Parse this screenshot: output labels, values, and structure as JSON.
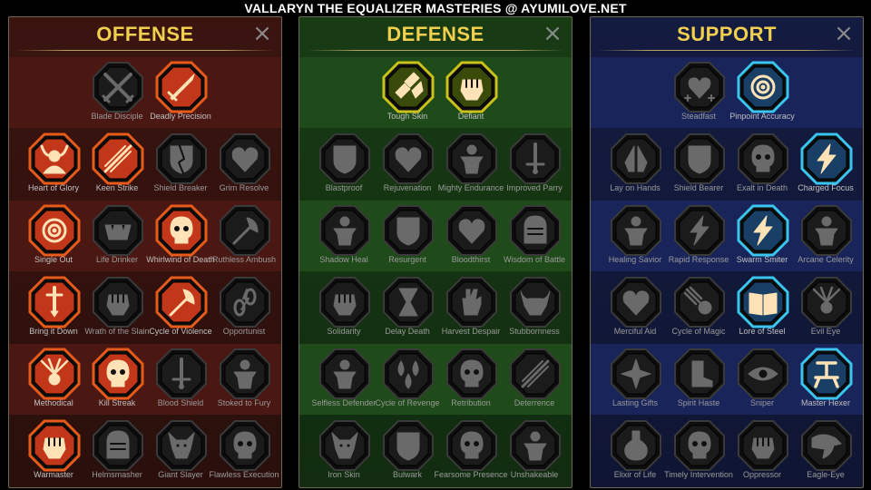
{
  "title": "VALLARYN THE EQUALIZER MASTERIES @ AYUMILOVE.NET",
  "close_glyph": "×",
  "panels": [
    {
      "id": "offense",
      "title": "OFFENSE",
      "colors": {
        "active_ring": "#e85a1a",
        "active_fill": "#c2361a",
        "tint": "#3b1410",
        "tier_band": "#4a1712"
      },
      "tiers": [
        [
          {
            "label": "Blade Disciple",
            "icon": "crossed-swords-icon",
            "active": false
          },
          {
            "label": "Deadly Precision",
            "icon": "dagger-icon",
            "active": true
          }
        ],
        [
          {
            "label": "Heart of Glory",
            "icon": "horned-warrior-icon",
            "active": true
          },
          {
            "label": "Keen Strike",
            "icon": "slash-icon",
            "active": true
          },
          {
            "label": "Shield Breaker",
            "icon": "broken-shield-icon",
            "active": false
          },
          {
            "label": "Grim Resolve",
            "icon": "heart-icon",
            "active": false
          }
        ],
        [
          {
            "label": "Single Out",
            "icon": "target-icon",
            "active": true
          },
          {
            "label": "Life Drinker",
            "icon": "fanged-mouth-icon",
            "active": false
          },
          {
            "label": "Whirlwind of Death",
            "icon": "skull-icon",
            "active": true
          },
          {
            "label": "Ruthless Ambush",
            "icon": "axe-icon",
            "active": false
          }
        ],
        [
          {
            "label": "Bring it Down",
            "icon": "sword-down-icon",
            "active": true
          },
          {
            "label": "Wrath of the Slain",
            "icon": "fist-icon",
            "active": false
          },
          {
            "label": "Cycle of Violence",
            "icon": "axe-icon",
            "active": true
          },
          {
            "label": "Opportunist",
            "icon": "chain-icon",
            "active": false
          }
        ],
        [
          {
            "label": "Methodical",
            "icon": "rays-icon",
            "active": true
          },
          {
            "label": "Kill Streak",
            "icon": "skull-icon",
            "active": true
          },
          {
            "label": "Blood Shield",
            "icon": "sword-icon",
            "active": false
          },
          {
            "label": "Stoked to Fury",
            "icon": "figure-icon",
            "active": false
          }
        ],
        [
          {
            "label": "Warmaster",
            "icon": "fist-icon",
            "active": true
          },
          {
            "label": "Helmsmasher",
            "icon": "helmet-icon",
            "active": false
          },
          {
            "label": "Giant Slayer",
            "icon": "demon-icon",
            "active": false
          },
          {
            "label": "Flawless Execution",
            "icon": "skull-icon",
            "active": false
          }
        ]
      ]
    },
    {
      "id": "defense",
      "title": "DEFENSE",
      "colors": {
        "active_ring": "#c8c21a",
        "active_fill": "#3a4a0a",
        "tint": "#183b14",
        "tier_band": "#1f4a19"
      },
      "tiers": [
        [
          {
            "label": "Tough Skin",
            "icon": "scales-icon",
            "active": true
          },
          {
            "label": "Defiant",
            "icon": "fist-icon",
            "active": true
          }
        ],
        [
          {
            "label": "Blastproof",
            "icon": "shield-icon",
            "active": false
          },
          {
            "label": "Rejuvenation",
            "icon": "heart-icon",
            "active": false
          },
          {
            "label": "Mighty Endurance",
            "icon": "figure-icon",
            "active": false
          },
          {
            "label": "Improved Parry",
            "icon": "sword-icon",
            "active": false
          }
        ],
        [
          {
            "label": "Shadow Heal",
            "icon": "figure-icon",
            "active": false
          },
          {
            "label": "Resurgent",
            "icon": "shield-icon",
            "active": false
          },
          {
            "label": "Bloodthirst",
            "icon": "heart-icon",
            "active": false
          },
          {
            "label": "Wisdom of Battle",
            "icon": "helmet-icon",
            "active": false
          }
        ],
        [
          {
            "label": "Solidarity",
            "icon": "fist-icon",
            "active": false
          },
          {
            "label": "Delay Death",
            "icon": "hourglass-icon",
            "active": false
          },
          {
            "label": "Harvest Despair",
            "icon": "hand-icon",
            "active": false
          },
          {
            "label": "Stubbornness",
            "icon": "bull-icon",
            "active": false
          }
        ],
        [
          {
            "label": "Selfless Defender",
            "icon": "figure-icon",
            "active": false
          },
          {
            "label": "Cycle of Revenge",
            "icon": "drops-icon",
            "active": false
          },
          {
            "label": "Retribution",
            "icon": "skull-icon",
            "active": false
          },
          {
            "label": "Deterrence",
            "icon": "slash-icon",
            "active": false
          }
        ],
        [
          {
            "label": "Iron Skin",
            "icon": "demon-icon",
            "active": false
          },
          {
            "label": "Bulwark",
            "icon": "shield-icon",
            "active": false
          },
          {
            "label": "Fearsome Presence",
            "icon": "skull-icon",
            "active": false
          },
          {
            "label": "Unshakeable",
            "icon": "figure-icon",
            "active": false
          }
        ]
      ]
    },
    {
      "id": "support",
      "title": "SUPPORT",
      "colors": {
        "active_ring": "#39c5ef",
        "active_fill": "#1a3f66",
        "tint": "#141b40",
        "tier_band": "#19245a"
      },
      "tiers": [
        [
          {
            "label": "Steadfast",
            "icon": "heart-plus-icon",
            "active": false
          },
          {
            "label": "Pinpoint Accuracy",
            "icon": "target-icon",
            "active": true
          }
        ],
        [
          {
            "label": "Lay on Hands",
            "icon": "hands-icon",
            "active": false
          },
          {
            "label": "Shield Bearer",
            "icon": "shield-icon",
            "active": false
          },
          {
            "label": "Exalt in Death",
            "icon": "skull-icon",
            "active": false
          },
          {
            "label": "Charged Focus",
            "icon": "lightning-icon",
            "active": true
          }
        ],
        [
          {
            "label": "Healing Savior",
            "icon": "figure-icon",
            "active": false
          },
          {
            "label": "Rapid Response",
            "icon": "lightning-icon",
            "active": false
          },
          {
            "label": "Swarm Smiter",
            "icon": "lightning-icon",
            "active": true
          },
          {
            "label": "Arcane Celerity",
            "icon": "figure-icon",
            "active": false
          }
        ],
        [
          {
            "label": "Merciful Aid",
            "icon": "heart-icon",
            "active": false
          },
          {
            "label": "Cycle of Magic",
            "icon": "comet-icon",
            "active": false
          },
          {
            "label": "Lore of Steel",
            "icon": "book-icon",
            "active": true
          },
          {
            "label": "Evil Eye",
            "icon": "rays-icon",
            "active": false
          }
        ],
        [
          {
            "label": "Lasting Gifts",
            "icon": "star-icon",
            "active": false
          },
          {
            "label": "Spirit Haste",
            "icon": "boot-icon",
            "active": false
          },
          {
            "label": "Sniper",
            "icon": "eye-icon",
            "active": false
          },
          {
            "label": "Master Hexer",
            "icon": "hex-rune-icon",
            "active": true
          }
        ],
        [
          {
            "label": "Elixir of Life",
            "icon": "flask-icon",
            "active": false
          },
          {
            "label": "Timely Intervention",
            "icon": "skull-icon",
            "active": false
          },
          {
            "label": "Oppressor",
            "icon": "fist-icon",
            "active": false
          },
          {
            "label": "Eagle-Eye",
            "icon": "eagle-icon",
            "active": false
          }
        ]
      ]
    }
  ]
}
